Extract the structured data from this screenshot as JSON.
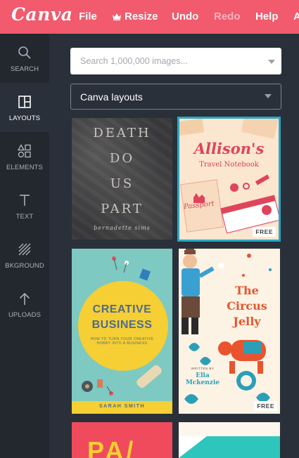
{
  "app": {
    "logo_text": "Canva"
  },
  "menu": {
    "file": "File",
    "resize": "Resize",
    "undo": "Undo",
    "redo": "Redo",
    "help": "Help",
    "overflow": "A"
  },
  "sidebar": {
    "items": [
      {
        "label": "SEARCH",
        "icon": "search-icon",
        "active": false
      },
      {
        "label": "LAYOUTS",
        "icon": "layouts-icon",
        "active": true
      },
      {
        "label": "ELEMENTS",
        "icon": "elements-icon",
        "active": false
      },
      {
        "label": "TEXT",
        "icon": "text-icon",
        "active": false
      },
      {
        "label": "BKGROUND",
        "icon": "background-icon",
        "active": false
      },
      {
        "label": "UPLOADS",
        "icon": "upload-icon",
        "active": false
      }
    ]
  },
  "search": {
    "placeholder": "Search 1,000,000 images..."
  },
  "filter": {
    "selected": "Canva layouts"
  },
  "layouts": {
    "free_badge": "FREE",
    "death": {
      "lines": [
        "DEATH",
        "DO",
        "US",
        "PART"
      ],
      "author": "bernadette sims"
    },
    "travel": {
      "title": "Allison's",
      "subtitle": "Travel Notebook",
      "passport": "Passport"
    },
    "creative": {
      "line1": "CREATIVE",
      "line2": "BUSINESS",
      "tagline": "HOW TO TURN YOUR CREATIVE HOBBY INTO A BUSINESS",
      "author": "SARAH SMITH"
    },
    "circus": {
      "line1": "The",
      "line2": "Circus",
      "line3": "Jelly",
      "written_by": "WRITTEN BY",
      "author": "Ella Mckenzie"
    },
    "partial": {
      "text": "PA/"
    }
  },
  "colors": {
    "topbar": "#f25a6d",
    "sidebar": "#23282f",
    "panel": "#293039",
    "selection": "#2aa7c4"
  }
}
